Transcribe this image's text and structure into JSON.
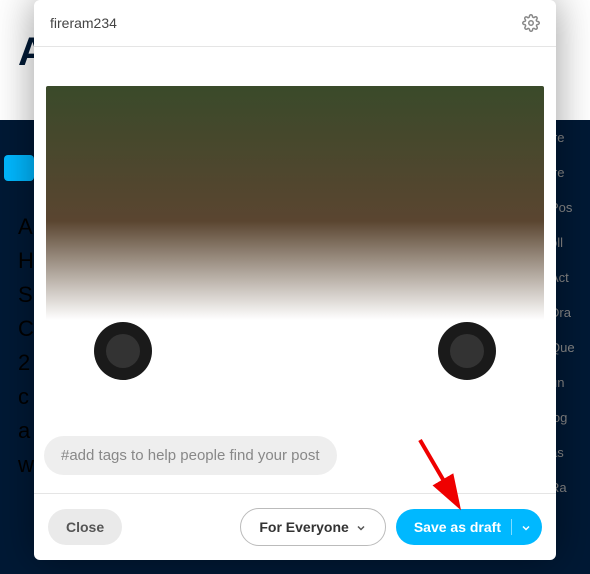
{
  "header": {
    "username": "fireram234",
    "gear_icon": "gear-icon"
  },
  "tags": {
    "placeholder": "#add tags to help people find your post"
  },
  "footer": {
    "close_label": "Close",
    "audience_label": "For Everyone",
    "primary_label": "Save as draft"
  },
  "bg": {
    "logo": "A",
    "left_lines": [
      "A",
      "H",
      "S",
      "C",
      "2",
      "c",
      "a",
      "w"
    ],
    "right_lines": [
      "ire",
      "ire",
      "Pos",
      "oll",
      "Act",
      "Dra",
      "Que",
      "un",
      "log",
      "as",
      "Ra"
    ]
  }
}
